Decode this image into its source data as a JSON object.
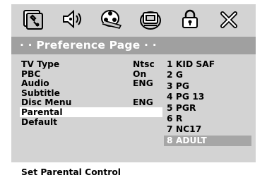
{
  "menu": {
    "icons": [
      "general-setup-icon",
      "speaker-setup-icon",
      "video-setup-icon",
      "preference-setup-icon",
      "password-lock-icon",
      "exit-icon"
    ]
  },
  "header": {
    "title": "· · Preference Page · ·"
  },
  "settings": [
    {
      "label": "TV Type",
      "value": "Ntsc"
    },
    {
      "label": "PBC",
      "value": "On"
    },
    {
      "label": "Audio",
      "value": "ENG"
    },
    {
      "label": "Subtitle",
      "value": ""
    },
    {
      "label": "Disc Menu",
      "value": "ENG"
    },
    {
      "label": "Parental",
      "value": ""
    },
    {
      "label": "Default",
      "value": ""
    }
  ],
  "selected_setting": "Parental",
  "ratings": [
    "1 KID SAF",
    "2 G",
    "3 PG",
    "4 PG 13",
    "5 PGR",
    "6 R",
    "7 NC17",
    "8 ADULT"
  ],
  "selected_rating": "8 ADULT",
  "status": {
    "text": "Set Parental Control"
  },
  "colors": {
    "panel": "#d3d3d3",
    "header": "#a0a0a0",
    "highlight": "#a6a6a6",
    "selected_row": "#ffffff",
    "text": "#000000"
  }
}
